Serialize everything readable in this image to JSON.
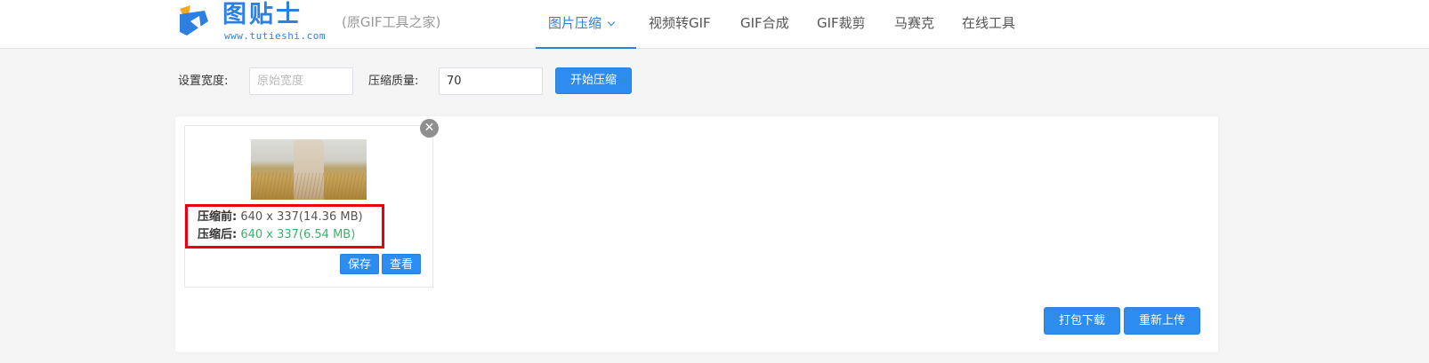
{
  "header": {
    "logo_title": "图贴士",
    "logo_url": "www.tutieshi.com",
    "logo_subtitle": "(原GIF工具之家)",
    "brand_color": "#2d7fe0",
    "nav": [
      {
        "label": "图片压缩",
        "active": true
      },
      {
        "label": "视频转GIF"
      },
      {
        "label": "GIF合成"
      },
      {
        "label": "GIF裁剪"
      },
      {
        "label": "马赛克"
      },
      {
        "label": "在线工具"
      }
    ]
  },
  "controls": {
    "width_label": "设置宽度:",
    "width_placeholder": "原始宽度",
    "width_value": "",
    "quality_label": "压缩质量:",
    "quality_value": "70",
    "start_button": "开始压缩"
  },
  "result": {
    "before_label": "压缩前:",
    "before_value": "640 x 337(14.36 MB)",
    "after_label": "压缩后:",
    "after_value": "640 x 337(6.54 MB)",
    "after_color": "#3bb26a",
    "save_button": "保存",
    "view_button": "查看",
    "close_icon": "close-icon"
  },
  "footer": {
    "download_button": "打包下载",
    "reupload_button": "重新上传"
  }
}
